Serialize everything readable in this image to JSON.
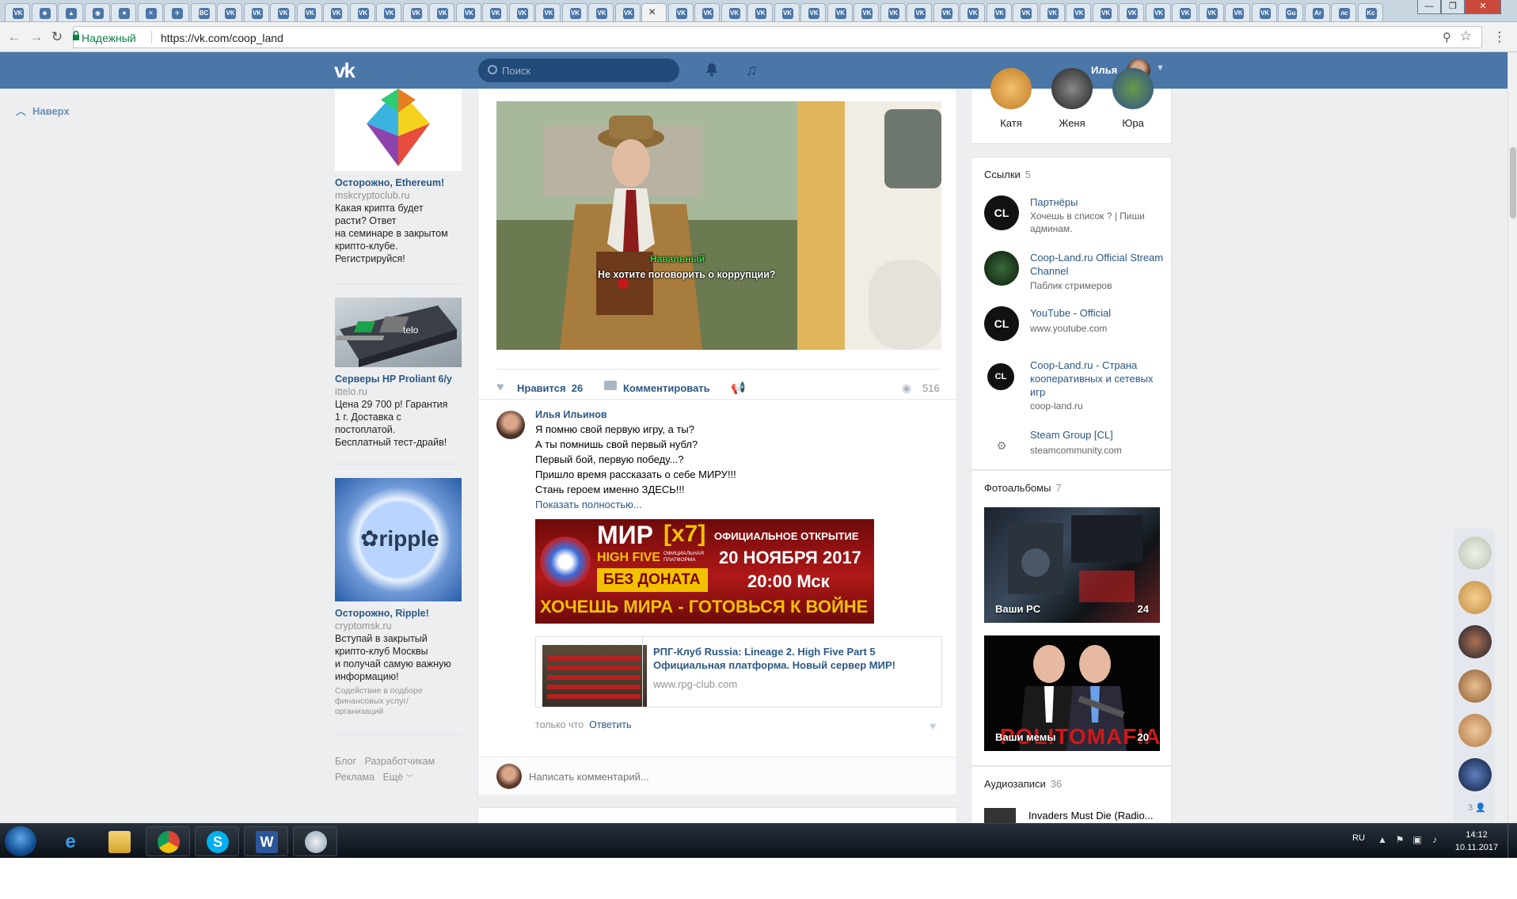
{
  "browser": {
    "tab_favicons": [
      "VK",
      "☻",
      "▲",
      "◉",
      "★",
      "✕",
      "✈",
      "BC",
      "VK",
      "VK",
      "VK",
      "VK",
      "VK",
      "VK",
      "VK",
      "VK",
      "VK",
      "VK",
      "VK",
      "VK",
      "VK",
      "VK",
      "VK",
      "VK",
      "VK",
      "VK",
      "VK",
      "VK",
      "VK",
      "VK",
      "VK",
      "VK",
      "VK",
      "VK",
      "VK",
      "VK",
      "VK",
      "VK",
      "VK",
      "VK",
      "VK",
      "VK",
      "VK",
      "VK",
      "VK",
      "VK",
      "VK",
      "VK",
      "Gu",
      "Ar",
      "лс",
      "Kc"
    ],
    "active_tab_close": "×",
    "secure_label": "Надежный",
    "url": "https://vk.com/coop_land",
    "window_controls": {
      "minimize": "—",
      "maximize": "❐",
      "close": "✕"
    }
  },
  "header": {
    "logo_text": "vk",
    "search_placeholder": "Поиск",
    "user_name": "Илья",
    "notifications_icon": "bell-icon",
    "music_icon": "music-note-icon"
  },
  "left_nav": {
    "back_to_top": "Наверх"
  },
  "ads": [
    {
      "title": "Осторожно, Ethereum!",
      "domain": "mskcryptoclub.ru",
      "text": [
        "Какая крипта будет",
        "расти? Ответ",
        "на семинаре в закрытом",
        "крипто-клубе.",
        "Регистрируйся!"
      ],
      "note": []
    },
    {
      "title": "Серверы HP Proliant 6/у",
      "domain": "ittelo.ru",
      "text": [
        "Цена 29 700 р! Гарантия",
        "1 г. Доставка с",
        "постоплатой.",
        "Бесплатный тест-драйв!"
      ],
      "note": []
    },
    {
      "title": "Осторожно, Ripple!",
      "domain": "cryptomsk.ru",
      "text": [
        "Вступай в закрытый",
        "крипто-клуб Москвы",
        "и получай самую важную",
        "информацию!"
      ],
      "note": [
        "Содействие в подборе",
        "финансовых услуг/",
        "организаций"
      ]
    }
  ],
  "ad_image_labels": {
    "server": "telo",
    "ripple": "ripple"
  },
  "footer_links": {
    "blog": "Блог",
    "developers": "Разработчикам",
    "ads": "Реклама",
    "more": "Ещё"
  },
  "post": {
    "image_subtitle_name": "Навальный",
    "image_subtitle_text": "Не хотите поговорить о коррупции?",
    "like_label": "Нравится",
    "like_count": "26",
    "comment_label": "Комментировать",
    "views": "516"
  },
  "comment": {
    "author": "Илья Ильинов",
    "lines": [
      "Я помню свой первую игру, а ты?",
      "А ты помнишь свой первый нубл?",
      "Первый бой, первую победу...?",
      "Пришло время рассказать о себе МИРУ!!!",
      "Стань героем именно ЗДЕСЬ!!!"
    ],
    "show_more": "Показать полностью...",
    "banner": {
      "title": "МИР",
      "x": "[x7]",
      "open": "ОФИЦИАЛЬНОЕ ОТКРЫТИЕ",
      "highfive": "HIGH FIVE",
      "platform": "ОФИЦИАЛЬНАЯ ПЛАТФОРМА",
      "date": "20 НОЯБРЯ 2017",
      "nodonate": "БЕЗ ДОНАТА",
      "time": "20:00 Мск",
      "slogan": "ХОЧЕШЬ МИРА - ГОТОВЬСЯ К ВОЙНЕ"
    },
    "link_title": "РПГ-Клуб Russia: Lineage 2. High Five Part 5 Официальная платформа. Новый сервер МИР!",
    "link_domain": "www.rpg-club.com",
    "time": "только что",
    "reply": "Ответить",
    "write_placeholder": "Написать комментарий..."
  },
  "friends": [
    {
      "name": "Катя",
      "color": "#e0a040"
    },
    {
      "name": "Женя",
      "color": "#333333"
    },
    {
      "name": "Юра",
      "color": "#4a6fa5"
    }
  ],
  "links_block": {
    "title": "Ссылки",
    "count": "5",
    "items": [
      {
        "avatar": "CL",
        "title": "Партнёры",
        "sub": "Хочешь в список ? | Пиши админам."
      },
      {
        "avatar": "",
        "title": "Coop-Land.ru Official Stream Channel",
        "sub": "Паблик стримеров"
      },
      {
        "avatar": "CL",
        "title": "YouTube - Official",
        "sub": "www.youtube.com"
      },
      {
        "avatar": "CL",
        "title": "Coop-Land.ru - Страна кооперативных и сетевых игр",
        "sub": "coop-land.ru"
      },
      {
        "avatar": "",
        "title": "Steam Group [CL]",
        "sub": "steamcommunity.com"
      }
    ]
  },
  "albums_block": {
    "title": "Фотоальбомы",
    "count": "7",
    "items": [
      {
        "label": "Ваши PC",
        "count": "24"
      },
      {
        "label": "Ваши мемы",
        "count": "20",
        "overlay": "POLITOMAFIA"
      }
    ]
  },
  "audio_block": {
    "title": "Аудиозаписи",
    "count": "36",
    "first_track": "Invaders Must Die (Radio..."
  },
  "chat": {
    "online_count": "3"
  },
  "taskbar": {
    "apps": [
      "ie-icon",
      "explorer-icon",
      "chrome-icon",
      "skype-icon",
      "word-icon",
      "paint-icon"
    ],
    "lang": "RU",
    "time": "14:12",
    "date": "10.11.2017"
  },
  "colors": {
    "vk_blue": "#4a76a8",
    "link": "#2a5885",
    "muted": "#939393"
  }
}
